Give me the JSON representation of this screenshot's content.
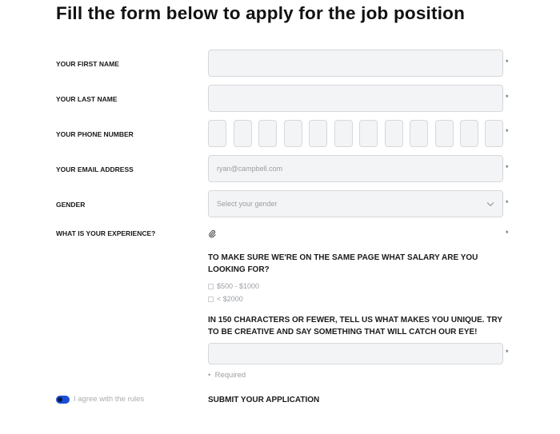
{
  "form": {
    "title": "Fill the form below to apply for the job position",
    "required_mark": "*",
    "first_name": {
      "label": "YOUR FIRST NAME",
      "value": ""
    },
    "last_name": {
      "label": "YOUR LAST NAME",
      "value": ""
    },
    "phone": {
      "label": "YOUR PHONE NUMBER",
      "digit_count": 12
    },
    "email": {
      "label": "YOUR EMAIL ADDRESS",
      "placeholder": "ryan@campbell.com"
    },
    "gender": {
      "label": "GENDER",
      "placeholder": "Select your gender"
    },
    "experience": {
      "label": "WHAT IS YOUR EXPERIENCE?",
      "icon": "paperclip-icon"
    },
    "salary": {
      "question": "TO MAKE SURE WE'RE ON THE SAME PAGE WHAT SALARY ARE YOU LOOKING FOR?",
      "options": [
        "$500 - $1000",
        "< $2000"
      ]
    },
    "unique": {
      "question": "IN 150 CHARACTERS OR FEWER, TELL US WHAT MAKES YOU UNIQUE. TRY TO BE CREATIVE AND SAY SOMETHING THAT WILL CATCH OUR EYE!",
      "hint": "Required"
    },
    "agree": {
      "label": "I agree with the rules",
      "checked": true
    },
    "submit_label": "SUBMIT YOUR APPLICATION"
  },
  "colors": {
    "accent": "#1a4fd6",
    "field_bg": "#f3f4f5",
    "field_border": "#d6d8db",
    "muted_text": "#9a9ea3"
  }
}
